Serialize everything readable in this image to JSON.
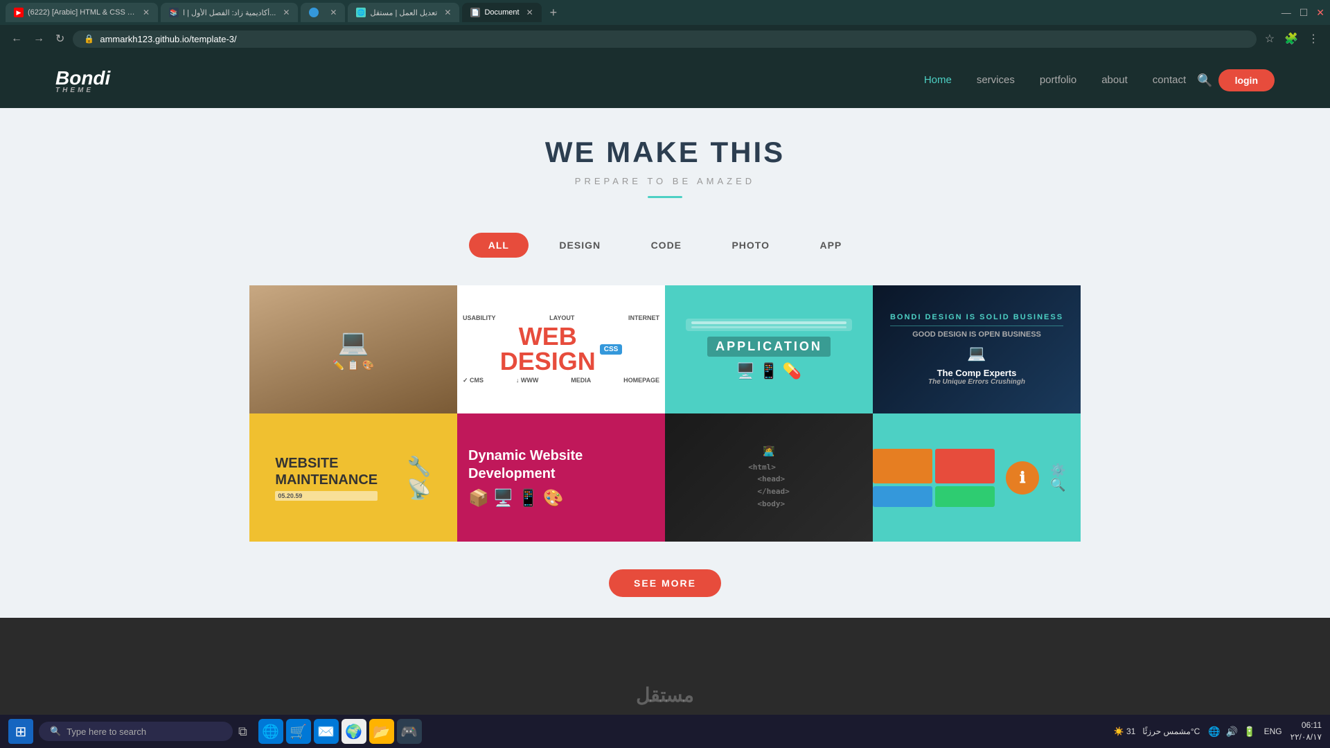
{
  "browser": {
    "tabs": [
      {
        "id": 1,
        "title": "(6222) [Arabic] HTML & CSS Tem...",
        "favicon": "▶",
        "active": false,
        "favicon_color": "#f00"
      },
      {
        "id": 2,
        "title": "أكاديمية زاد: الفصل الأول | ا...",
        "favicon": "📚",
        "active": false,
        "favicon_color": "#ccc"
      },
      {
        "id": 3,
        "title": "",
        "favicon": "🔵",
        "active": false,
        "favicon_color": "#3498db"
      },
      {
        "id": 4,
        "title": "تعديل العمل | مستقل",
        "favicon": "🌐",
        "active": false,
        "favicon_color": "#4dd0c4"
      },
      {
        "id": 5,
        "title": "Document",
        "favicon": "📄",
        "active": true,
        "favicon_color": "#fff"
      }
    ],
    "address": "ammarkh123.github.io/template-3/",
    "new_tab_label": "+",
    "win_controls": [
      "—",
      "☐",
      "✕"
    ]
  },
  "site": {
    "logo": "Bondi",
    "logo_sub": "THEME",
    "nav": {
      "links": [
        {
          "label": "Home",
          "active": true
        },
        {
          "label": "services",
          "active": false
        },
        {
          "label": "portfolio",
          "active": false
        },
        {
          "label": "about",
          "active": false
        },
        {
          "label": "contact",
          "active": false
        }
      ],
      "login": "login"
    },
    "hero": {
      "title": "WE MAKE THIS",
      "subtitle": "PREPARE TO BE AMAZED"
    },
    "filters": [
      {
        "label": "ALL",
        "active": true
      },
      {
        "label": "DESIGN",
        "active": false
      },
      {
        "label": "CODE",
        "active": false
      },
      {
        "label": "PHOTO",
        "active": false
      },
      {
        "label": "APP",
        "active": false
      }
    ],
    "portfolio": {
      "items": [
        {
          "id": 1,
          "type": "laptop-desk",
          "alt": "Laptop desk workspace"
        },
        {
          "id": 2,
          "type": "web-design",
          "alt": "Web Design",
          "title": "WEB\nDESIGN"
        },
        {
          "id": 3,
          "type": "application",
          "alt": "Application",
          "title": "APPLICATION"
        },
        {
          "id": 4,
          "type": "experts",
          "alt": "The Comp Experts"
        },
        {
          "id": 5,
          "type": "maintenance",
          "alt": "Website Maintenance",
          "title": "WEBSITE\nMAINTENANCE"
        },
        {
          "id": 6,
          "type": "dynamic",
          "alt": "Dynamic Website Development",
          "title": "Dynamic Website Development"
        },
        {
          "id": 7,
          "type": "coding",
          "alt": "Coding workspace"
        },
        {
          "id": 8,
          "type": "info-design",
          "alt": "Info design"
        }
      ]
    },
    "see_more": "SEE MORE"
  },
  "taskbar": {
    "search_placeholder": "Type here to search",
    "apps": [
      "🌐",
      "📁",
      "🛒",
      "✉️",
      "🌍",
      "📂",
      "🎮"
    ],
    "weather": "☀️ مشمس حرزئًا  31°C",
    "system_icons": [
      "🔼",
      "🌐",
      "🔊",
      "🔋"
    ],
    "lang": "ENG",
    "time": "06:11",
    "date": "٢٢/٠٨/١٧"
  },
  "watermark": "مستقل"
}
